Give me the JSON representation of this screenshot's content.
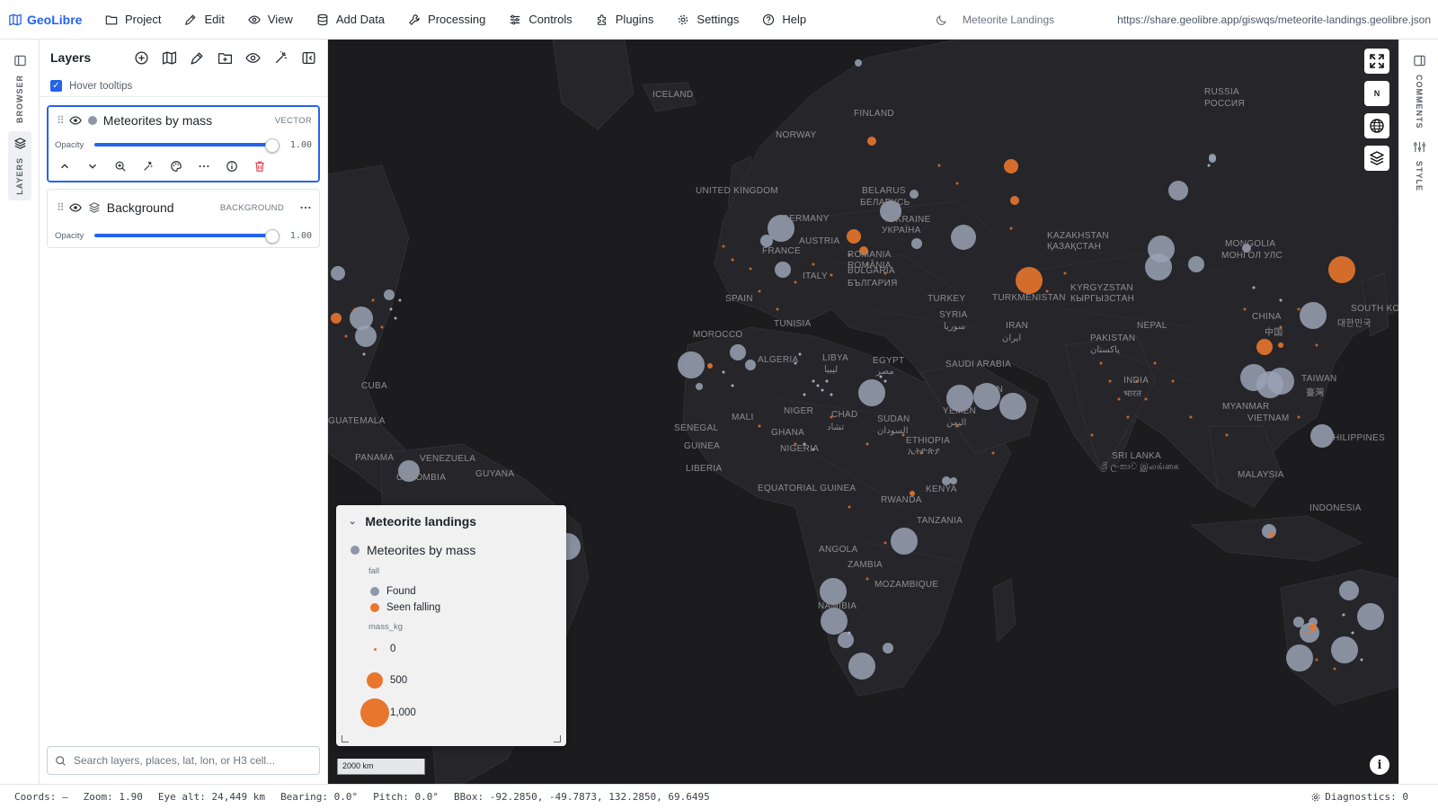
{
  "app": {
    "brand": "GeoLibre",
    "project_name": "Meteorite Landings",
    "share_url": "https://share.geolibre.app/giswqs/meteorite-landings.geolibre.json"
  },
  "menu": [
    {
      "label": "Project",
      "icon": "folder-icon"
    },
    {
      "label": "Edit",
      "icon": "pencil-icon"
    },
    {
      "label": "View",
      "icon": "eye-icon"
    },
    {
      "label": "Add Data",
      "icon": "database-icon"
    },
    {
      "label": "Processing",
      "icon": "wrench-icon"
    },
    {
      "label": "Controls",
      "icon": "sliders-icon"
    },
    {
      "label": "Plugins",
      "icon": "puzzle-icon"
    },
    {
      "label": "Settings",
      "icon": "gear-icon"
    },
    {
      "label": "Help",
      "icon": "help-circle-icon"
    }
  ],
  "left_rail": {
    "browser_label": "BROWSER",
    "layers_label": "LAYERS"
  },
  "right_rail": {
    "comments_label": "COMMENTS",
    "style_label": "STYLE"
  },
  "layers_panel": {
    "title": "Layers",
    "hover_tooltips": {
      "label": "Hover tooltips",
      "checked": true
    },
    "opacity_label": "Opacity",
    "layers": [
      {
        "name": "Meteorites by mass",
        "type": "VECTOR",
        "opacity": "1.00",
        "opacity_fraction": 1.0,
        "selected": true,
        "swatch": "#8e96a7"
      },
      {
        "name": "Background",
        "type": "BACKGROUND",
        "opacity": "1.00",
        "opacity_fraction": 1.0,
        "selected": false
      }
    ],
    "search_placeholder": "Search layers, places, lat, lon, or H3 cell..."
  },
  "map": {
    "labels": [
      "ICELAND",
      "FINLAND",
      "NORWAY",
      "RUSSIA",
      "РОССИЯ",
      "UNITED KINGDOM",
      "BELARUS",
      "БЕЛАРУСЬ",
      "UKRAINE",
      "УКРАЇНА",
      "GERMANY",
      "FRANCE",
      "AUSTRIA",
      "ROMANIA",
      "ROMÂNIA",
      "BULGARIA",
      "БЪЛГАРИЯ",
      "ITALY",
      "SPAIN",
      "TURKEY",
      "KAZAKHSTAN",
      "ҚАЗАҚСТАН",
      "MONGOLIA",
      "МОНГОЛ УЛС",
      "KYRGYZSTAN",
      "КЫРГЫЗСТАН",
      "TURKMENISTAN",
      "TUNISIA",
      "SYRIA",
      "سوريا",
      "IRAN",
      "ایران",
      "PAKISTAN",
      "پاکستان",
      "NEPAL",
      "CHINA",
      "中国",
      "SOUTH KOREA",
      "대한민국",
      "MOROCCO",
      "ALGERIA",
      "LIBYA",
      "ليبيا",
      "EGYPT",
      "مصر",
      "SAUDI ARABIA",
      "INDIA",
      "भारत",
      "TAIWAN",
      "臺灣",
      "MYANMAR",
      "VIETNAM",
      "CUBA",
      "MALI",
      "NIGER",
      "CHAD",
      "تشاد",
      "SUDAN",
      "السودان",
      "YEMEN",
      "اليمن",
      "OMAN",
      "SENEGAL",
      "GUINEA",
      "ETHIOPIA",
      "ኢትዮጵያ",
      "SRI LANKA",
      "ශ්‍රී ලංකාව இலங்கை",
      "PHILIPPINES",
      "GHANA",
      "LIBERIA",
      "NIGERIA",
      "GUATEMALA",
      "PANAMA",
      "VENEZUELA",
      "GUYANA",
      "COLOMBIA",
      "EQUATORIAL GUINEA",
      "KENYA",
      "MALAYSIA",
      "RWANDA",
      "TANZANIA",
      "INDONESIA",
      "ANGOLA",
      "ZAMBIA",
      "MOZAMBIQUE",
      "NAMIBIA"
    ],
    "controls": [
      {
        "name": "fullscreen-button",
        "icon": "fullscreen-icon"
      },
      {
        "name": "compass-button",
        "label": "N"
      },
      {
        "name": "globe-button",
        "icon": "globe-icon"
      },
      {
        "name": "basemap-button",
        "icon": "layers-stack-icon"
      }
    ],
    "scale_label": "2000 km",
    "attribution_label": "i"
  },
  "legend": {
    "title": "Meteorite landings",
    "layer_name": "Meteorites by mass",
    "category_field": "fall",
    "categories": [
      {
        "label": "Found",
        "color": "#8e96a7"
      },
      {
        "label": "Seen falling",
        "color": "#e8762c"
      }
    ],
    "size_field": "mass_kg",
    "sizes": [
      {
        "label": "0",
        "value": 0
      },
      {
        "label": "500",
        "value": 500
      },
      {
        "label": "1,000",
        "value": 1000
      }
    ]
  },
  "status": {
    "coords": "Coords: —",
    "zoom": "Zoom: 1.90",
    "eye_alt": "Eye alt: 24,449 km",
    "bearing": "Bearing: 0.0°",
    "pitch": "Pitch: 0.0°",
    "bbox": "BBox: -92.2850, -49.7873, 132.2850, 69.6495",
    "diagnostics": "Diagnostics: 0"
  },
  "colors": {
    "accent": "#2563eb",
    "map_bg": "#1c1c1e",
    "land": "#26262a",
    "found": "#9aa3b5",
    "fell": "#e8762c",
    "delete": "#e5484d"
  }
}
